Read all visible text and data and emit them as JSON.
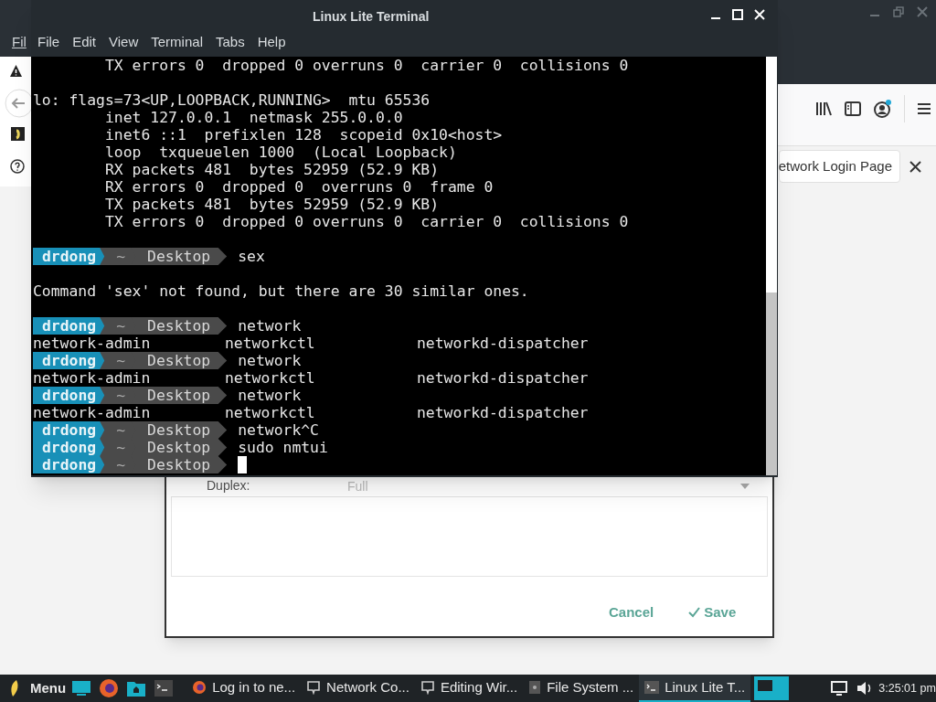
{
  "browser": {
    "menu_fragment": "Fil",
    "tab_title": "etwork Login Page"
  },
  "dialog": {
    "field_label": "Duplex:",
    "field_value": "Full",
    "buttons": [
      {
        "label": "Cancel",
        "kind": "plain"
      },
      {
        "label": "Save",
        "kind": "check"
      }
    ]
  },
  "terminal": {
    "title": "Linux Lite Terminal",
    "menu": [
      "File",
      "Edit",
      "View",
      "Terminal",
      "Tabs",
      "Help"
    ],
    "lines": [
      {
        "kind": "text",
        "text": "        TX errors 0  dropped 0 overruns 0  carrier 0  collisions 0"
      },
      {
        "kind": "blank"
      },
      {
        "kind": "text",
        "text": "lo: flags=73<UP,LOOPBACK,RUNNING>  mtu 65536"
      },
      {
        "kind": "text",
        "text": "        inet 127.0.0.1  netmask 255.0.0.0"
      },
      {
        "kind": "text",
        "text": "        inet6 ::1  prefixlen 128  scopeid 0x10<host>"
      },
      {
        "kind": "text",
        "text": "        loop  txqueuelen 1000  (Local Loopback)"
      },
      {
        "kind": "text",
        "text": "        RX packets 481  bytes 52959 (52.9 KB)"
      },
      {
        "kind": "text",
        "text": "        RX errors 0  dropped 0  overruns 0  frame 0"
      },
      {
        "kind": "text",
        "text": "        TX packets 481  bytes 52959 (52.9 KB)"
      },
      {
        "kind": "text",
        "text": "        TX errors 0  dropped 0 overruns 0  carrier 0  collisions 0"
      },
      {
        "kind": "blank"
      },
      {
        "kind": "prompt",
        "user": "drdong",
        "home": "~",
        "dir": "Desktop",
        "command": "sex"
      },
      {
        "kind": "blank"
      },
      {
        "kind": "text",
        "text": "Command 'sex' not found, but there are 30 similar ones."
      },
      {
        "kind": "blank"
      },
      {
        "kind": "prompt",
        "user": "drdong",
        "home": "~",
        "dir": "Desktop",
        "command": "network"
      },
      {
        "kind": "columns",
        "cells": [
          "network-admin",
          "networkctl",
          "networkd-dispatcher"
        ]
      },
      {
        "kind": "prompt",
        "user": "drdong",
        "home": "~",
        "dir": "Desktop",
        "command": "network"
      },
      {
        "kind": "columns",
        "cells": [
          "network-admin",
          "networkctl",
          "networkd-dispatcher"
        ]
      },
      {
        "kind": "prompt",
        "user": "drdong",
        "home": "~",
        "dir": "Desktop",
        "command": "network"
      },
      {
        "kind": "columns",
        "cells": [
          "network-admin",
          "networkctl",
          "networkd-dispatcher"
        ]
      },
      {
        "kind": "prompt",
        "user": "drdong",
        "home": "~",
        "dir": "Desktop",
        "command": "network^C"
      },
      {
        "kind": "prompt",
        "user": "drdong",
        "home": "~",
        "dir": "Desktop",
        "command": "sudo nmtui"
      },
      {
        "kind": "prompt",
        "user": "drdong",
        "home": "~",
        "dir": "Desktop",
        "cursor": true
      }
    ]
  },
  "taskbar": {
    "menu_label": "Menu",
    "tasks": [
      {
        "label": "Log in to ne...",
        "kind": "firefox",
        "selected": false
      },
      {
        "label": "Network Co...",
        "kind": "network",
        "selected": false
      },
      {
        "label": "Editing Wir...",
        "kind": "network",
        "selected": false
      },
      {
        "label": "File System ...",
        "kind": "disk",
        "selected": false
      },
      {
        "label": "Linux Lite T...",
        "kind": "terminal",
        "selected": true
      }
    ],
    "clock": "3:25:01 pm"
  }
}
